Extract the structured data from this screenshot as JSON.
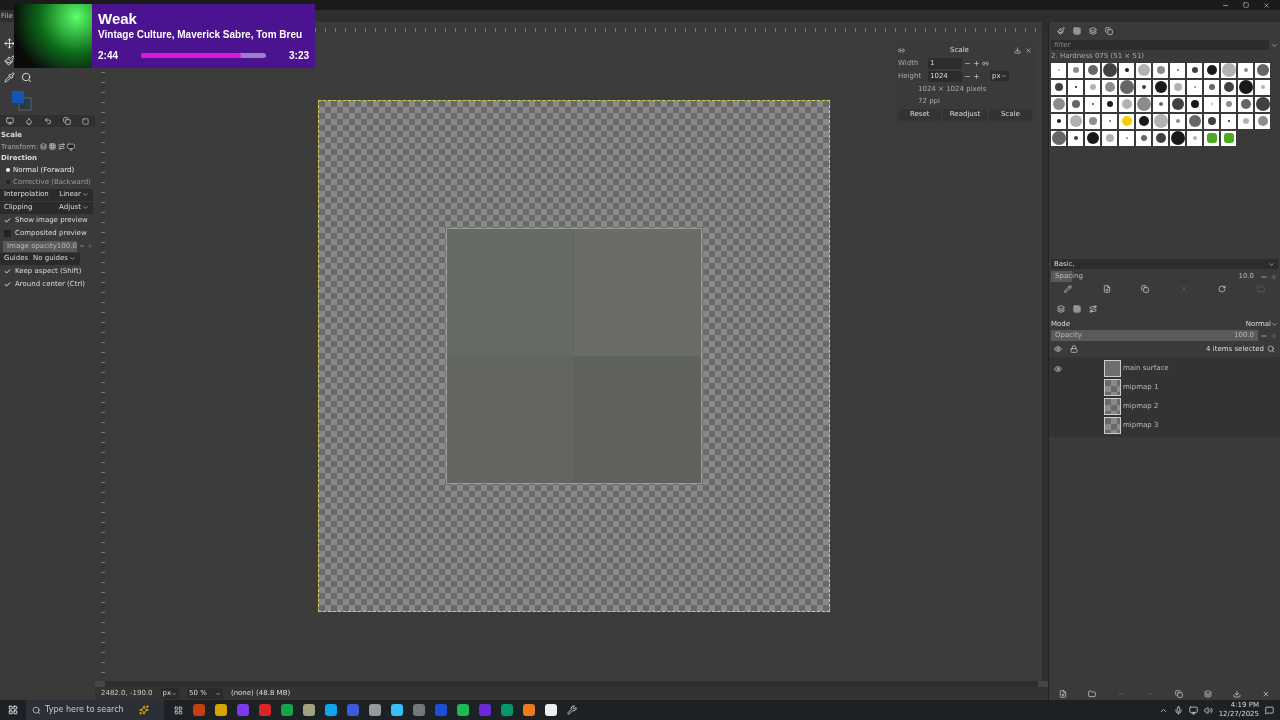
{
  "menu": [
    "File"
  ],
  "now_playing": {
    "title": "Weak",
    "artists": "Vintage Culture, Maverick Sabre, Tom Breu",
    "elapsed": "2:44",
    "total": "3:23",
    "level": 0.8
  },
  "tool_options": {
    "title": "Scale",
    "transform_label": "Transform:",
    "direction_label": "Direction",
    "directions": [
      {
        "label": "Normal (Forward)",
        "selected": true
      },
      {
        "label": "Corrective (Backward)",
        "selected": false
      }
    ],
    "interpolation": {
      "label": "Interpolation",
      "value": "Linear"
    },
    "clipping": {
      "label": "Clipping",
      "value": "Adjust"
    },
    "preview_checks": [
      {
        "label": "Show image preview",
        "checked": true
      },
      {
        "label": "Composited preview",
        "checked": false
      }
    ],
    "image_opacity": {
      "label": "Image opacity",
      "value": "100.0",
      "level": 1
    },
    "guides": {
      "label": "Guides",
      "value": "No guides"
    },
    "constraint_checks": [
      {
        "label": "Keep aspect (Shift)",
        "checked": true
      },
      {
        "label": "Around center (Ctrl)",
        "checked": true
      }
    ]
  },
  "scale_dialog": {
    "title": "Scale",
    "width_label": "Width",
    "width_value": "1",
    "height_label": "Height",
    "height_value": "1024",
    "unit": "px",
    "size_info": "1024 × 1024 pixels",
    "resolution": "72 ppi",
    "buttons": [
      "Reset",
      "Readjust",
      "Scale"
    ]
  },
  "brushes": {
    "filter_placeholder": "filter",
    "brush_name": "2. Hardness 075 (51 × 51)",
    "preset": "Basic,",
    "spacing": {
      "label": "Spacing",
      "value": "10.0",
      "level": 0.1
    }
  },
  "layers": {
    "mode_label": "Mode",
    "mode": "Normal",
    "opacity": {
      "label": "Opacity",
      "value": "100.0",
      "level": 1
    },
    "selected_count": "4 items selected",
    "items": [
      {
        "name": "main surface",
        "visible": true,
        "kind": "solid"
      },
      {
        "name": "mipmap 1",
        "visible": false,
        "kind": "checker"
      },
      {
        "name": "mipmap 2",
        "visible": false,
        "kind": "checker"
      },
      {
        "name": "mipmap 3",
        "visible": false,
        "kind": "checker"
      }
    ]
  },
  "status_bar": {
    "coords": "2482.0, -190.0",
    "unit": "px",
    "zoom": "50 %",
    "info": "(none) (48.8 MB)"
  },
  "taskbar": {
    "search_placeholder": "Type here to search",
    "time": "4:19 PM",
    "date": "12/27/2025"
  }
}
